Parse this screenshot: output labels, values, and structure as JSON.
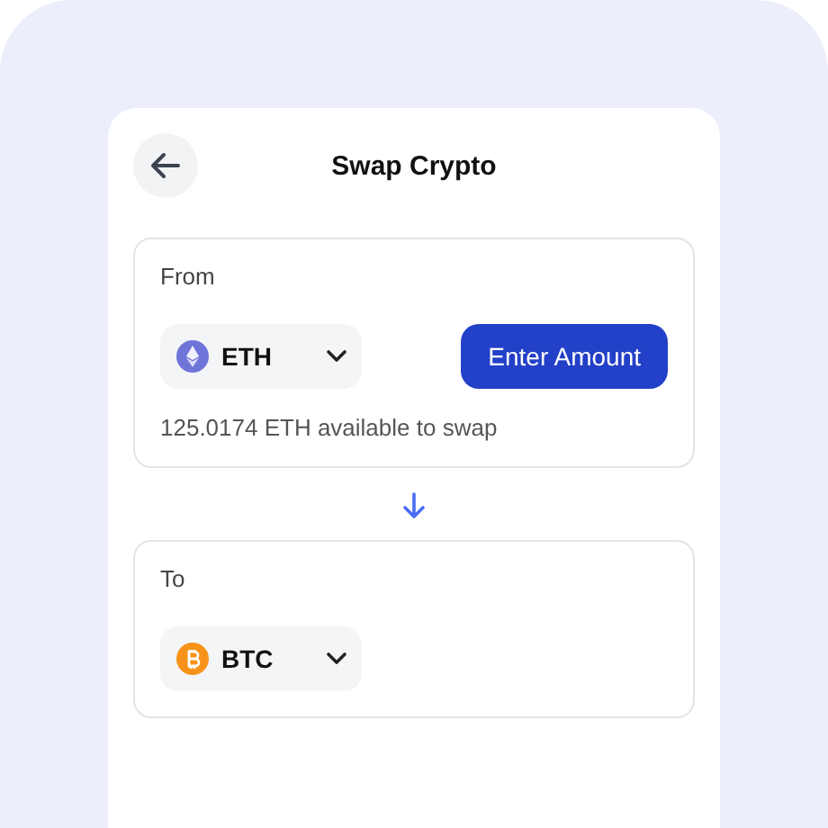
{
  "header": {
    "title": "Swap Crypto"
  },
  "from": {
    "label": "From",
    "coin": {
      "kind": "eth",
      "symbol": "ETH"
    },
    "button": "Enter Amount",
    "balance": "125.0174 ETH available to swap"
  },
  "to": {
    "label": "To",
    "coin": {
      "kind": "btc",
      "symbol": "BTC"
    }
  }
}
